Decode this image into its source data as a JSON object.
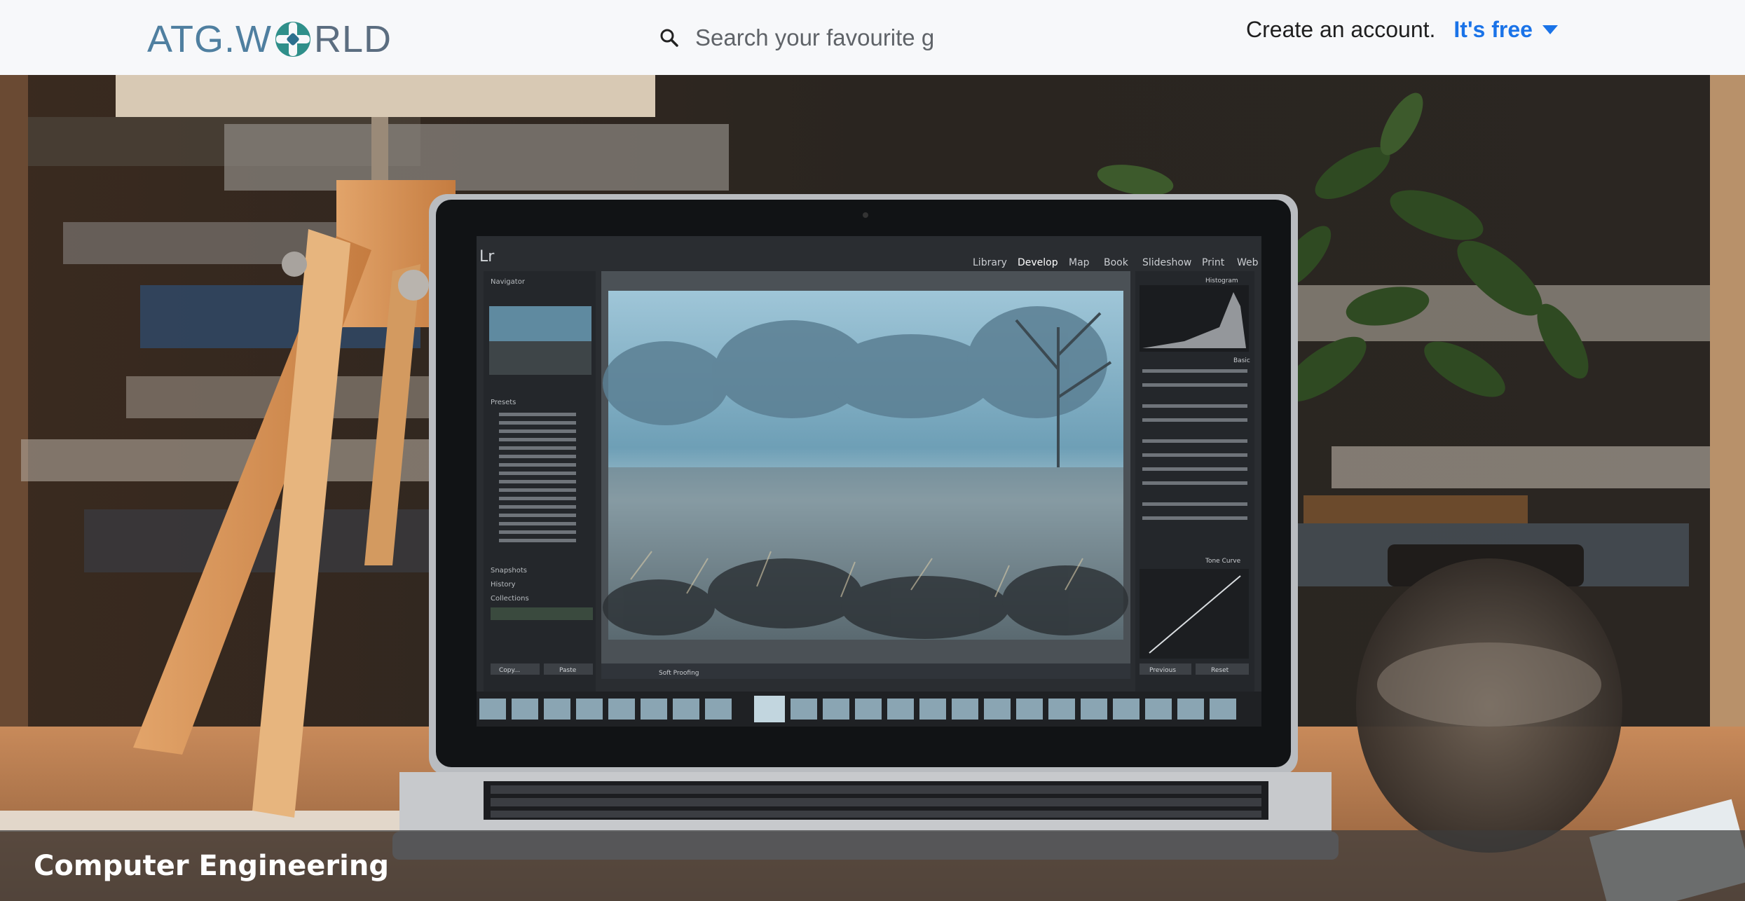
{
  "header": {
    "logo": {
      "text_part1": "ATG.W",
      "text_part2": "RLD"
    },
    "search": {
      "placeholder": "Search your favourite gr"
    },
    "account": {
      "prompt": "Create an account.",
      "cta": "It's free"
    }
  },
  "hero": {
    "caption": "Computer Engineering",
    "lightroom": {
      "logo": "Lr",
      "modules": [
        "Library",
        "Develop",
        "Map",
        "Book",
        "Slideshow",
        "Print",
        "Web"
      ],
      "left_panels": [
        "Navigator",
        "Presets",
        "Snapshots",
        "History",
        "Collections"
      ],
      "right_panels": [
        "Histogram",
        "Basic",
        "Tone Curve"
      ],
      "buttons": [
        "Copy...",
        "Paste",
        "Previous",
        "Reset"
      ],
      "toolbar_label": "Soft Proofing"
    }
  },
  "colors": {
    "accent": "#1a73e8",
    "logo_blue": "#4f7fa0",
    "logo_teal": "#2f8f8a",
    "caption_overlay": "#3c3c3c"
  },
  "icons": [
    "search-icon",
    "caret-down-icon",
    "logo-mark-icon"
  ]
}
